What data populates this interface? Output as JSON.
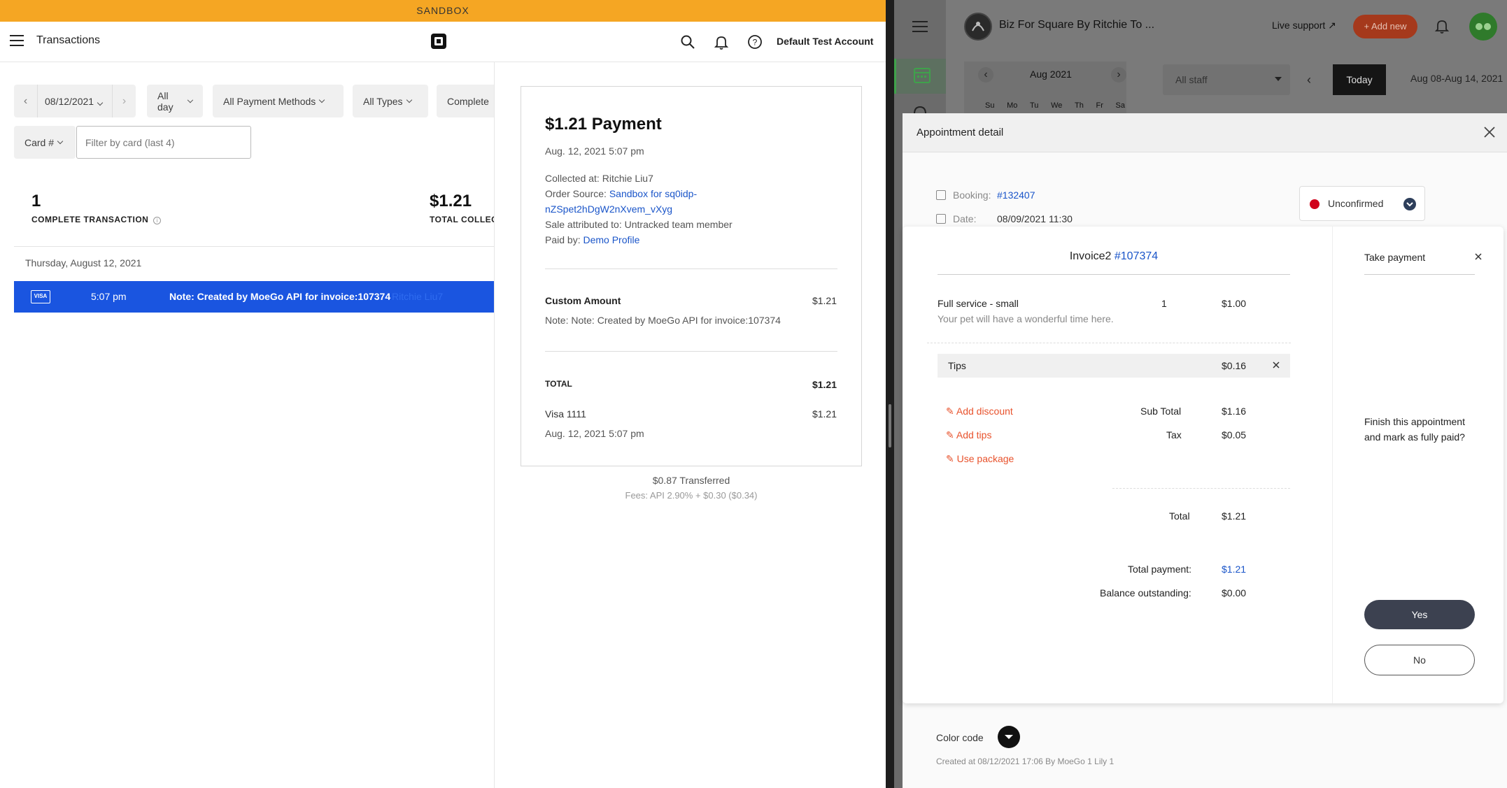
{
  "left": {
    "sandbox": "SANDBOX",
    "title": "Transactions",
    "account": "Default Test Account",
    "filters": {
      "date": "08/12/2021",
      "time": "All day",
      "methods": "All Payment Methods",
      "types": "All Types",
      "status": "Complete",
      "card": "Card #",
      "card_placeholder": "Filter by card (last 4)"
    },
    "summary": {
      "count": "1",
      "count_label": "COMPLETE TRANSACTION",
      "total": "$1.21",
      "total_label": "TOTAL COLLECTED"
    },
    "day_header": "Thursday, August 12, 2021",
    "row": {
      "card_brand": "VISA",
      "time": "5:07 pm",
      "note": "Note: Created by MoeGo API for invoice:107374",
      "person": "Ritchie Liu7"
    }
  },
  "receipt": {
    "title": "$1.21 Payment",
    "datetime": "Aug. 12, 2021 5:07 pm",
    "collected_label": "Collected at:",
    "collected": "Ritchie Liu7",
    "order_label": "Order Source:",
    "order_line1": "Sandbox for sq0idp-",
    "order_line2": "nZSpet2hDgW2nXvem_vXyg",
    "attributed": "Sale attributed to: Untracked team member",
    "paid_label": "Paid by:",
    "paid_by": "Demo Profile",
    "item_name": "Custom Amount",
    "item_amount": "$1.21",
    "item_note": "Note: Note: Created by MoeGo API for invoice:107374",
    "total_label": "TOTAL",
    "total": "$1.21",
    "card": "Visa 1111",
    "card_amount": "$1.21",
    "card_datetime": "Aug. 12, 2021 5:07 pm",
    "transferred": "$0.87 Transferred",
    "fees": "Fees: API 2.90% + $0.30 ($0.34)"
  },
  "right": {
    "business": "Biz For Square By Ritchie To ...",
    "live_support": "Live support",
    "add_new": "+ Add new",
    "month": "Aug 2021",
    "weekdays": [
      "Su",
      "Mo",
      "Tu",
      "We",
      "Th",
      "Fr",
      "Sa"
    ],
    "staff": "All staff",
    "today": "Today",
    "range": "Aug 08-Aug 14, 2021",
    "modal_title": "Appointment detail",
    "booking_label": "Booking:",
    "booking": "#132407",
    "date_label": "Date:",
    "date": "08/09/2021 11:30",
    "status": "Unconfirmed",
    "color_code": "Color code",
    "created": "Created at 08/12/2021 17:06 By MoeGo 1 Lily 1"
  },
  "invoice": {
    "title": "Invoice2",
    "number": "#107374",
    "service": "Full service - small",
    "service_desc": "Your pet will have a wonderful time here.",
    "qty": "1",
    "price": "$1.00",
    "tips_label": "Tips",
    "tips": "$0.16",
    "add_discount": "Add discount",
    "add_tips": "Add tips",
    "use_package": "Use package",
    "subtotal_label": "Sub Total",
    "subtotal": "$1.16",
    "tax_label": "Tax",
    "tax": "$0.05",
    "total_label": "Total",
    "total": "$1.21",
    "total_payment_label": "Total payment:",
    "total_payment": "$1.21",
    "balance_label": "Balance outstanding:",
    "balance": "$0.00",
    "take_payment": "Take payment",
    "finish_text": "Finish this appointment and mark as fully paid?",
    "yes": "Yes",
    "no": "No"
  },
  "colors": {
    "sandbox": "#f5a623",
    "selected_row": "#1a55e0",
    "link": "#1a55c9",
    "orange": "#e8522c",
    "dark_button": "#3c4150"
  }
}
